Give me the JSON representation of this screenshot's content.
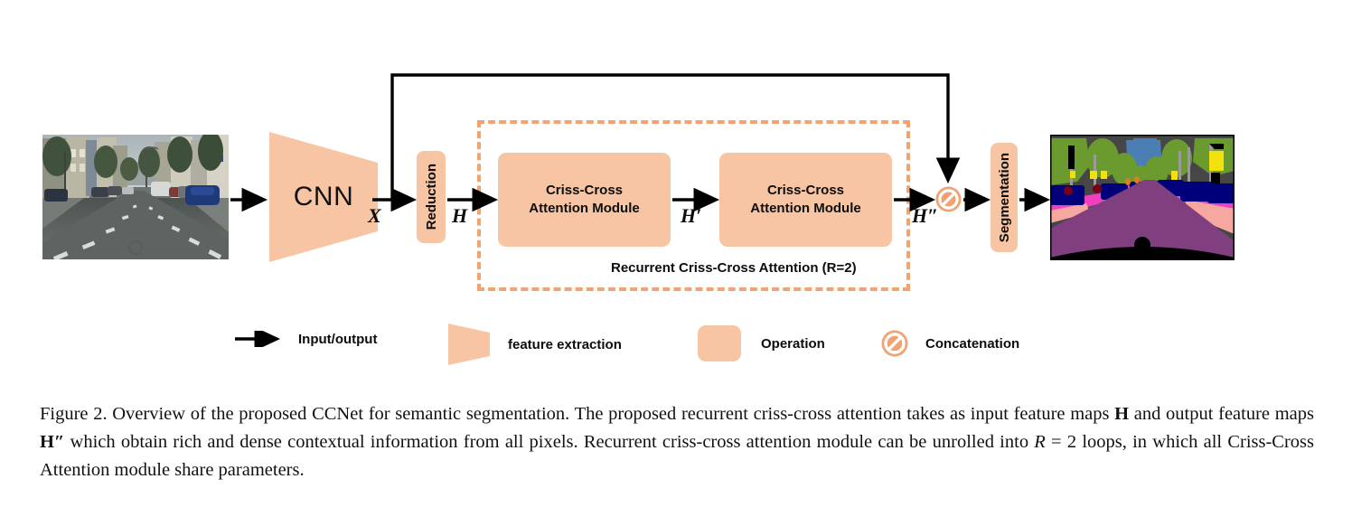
{
  "figure": {
    "pipeline": {
      "input_image": {
        "name": "input street scene photo",
        "alt": "urban street with parked cars"
      },
      "backbone": {
        "label": "CNN",
        "shape": "trapezoid"
      },
      "reduction": {
        "label": "Reduction"
      },
      "attention_modules": [
        {
          "line1": "Criss-Cross",
          "line2": "Attention Module"
        },
        {
          "line1": "Criss-Cross",
          "line2": "Attention Module"
        }
      ],
      "recurrent_box": {
        "caption": "Recurrent Criss-Cross Attention (R=2)"
      },
      "concat": {
        "name": "concatenation",
        "symbol": "no-entry"
      },
      "segmentation": {
        "label": "Segmentation"
      },
      "output_image": {
        "name": "semantic segmentation map",
        "alt": "color coded segmentation of the street scene"
      },
      "flow_labels": {
        "x": "X",
        "h": "H",
        "h_prime": "H′",
        "h_double_prime": "H″"
      }
    },
    "legend": [
      {
        "icon": "arrow",
        "label": "Input/output"
      },
      {
        "icon": "trapezoid",
        "label": "feature extraction"
      },
      {
        "icon": "rounded-box",
        "label": "Operation"
      },
      {
        "icon": "no-entry",
        "label": "Concatenation"
      }
    ],
    "caption": {
      "prefix": "Figure 2.",
      "text": "Overview of the proposed CCNet for semantic segmentation. The proposed recurrent criss-cross attention takes as input feature maps H and output feature maps H″ which obtain rich and dense contextual information from all pixels. Recurrent criss-cross attention module can be unrolled into R = 2 loops, in which all Criss-Cross Attention module share parameters.",
      "segments": [
        {
          "t": "Figure 2. Overview of the proposed CCNet for semantic segmentation. The proposed recurrent criss-cross attention takes as input feature ",
          "s": "plain"
        },
        {
          "t": "maps ",
          "s": "plain"
        },
        {
          "t": "H",
          "s": "bold"
        },
        {
          "t": " and output feature maps ",
          "s": "plain"
        },
        {
          "t": "H″",
          "s": "bold"
        },
        {
          "t": " which obtain rich and dense contextual information from all pixels. Recurrent criss-cross attention ",
          "s": "plain"
        },
        {
          "t": "module can be unrolled into ",
          "s": "plain"
        },
        {
          "t": "R",
          "s": "italic"
        },
        {
          "t": " = 2 loops, in which all Criss-Cross Attention module share parameters.",
          "s": "plain"
        }
      ]
    },
    "colors": {
      "operation_fill": "#F7C5A3",
      "dashed_border": "#F3A272",
      "arrow": "#000000",
      "text": "#0d0d0d",
      "concat_ring": "#EFA274"
    }
  }
}
